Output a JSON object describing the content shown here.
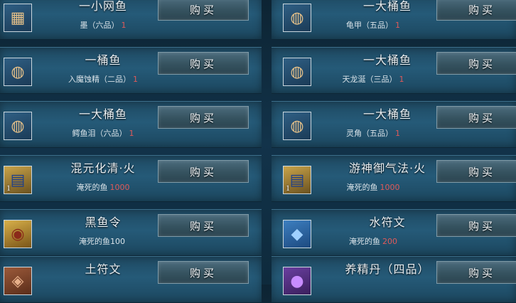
{
  "buy_label": "购买",
  "items": [
    {
      "name": "一小网鱼",
      "cost_text": "墨（六品）",
      "cost_num": "1",
      "icon": "net-icon",
      "icon_qty": ""
    },
    {
      "name": "一大桶鱼",
      "cost_text": "龟甲（五品）",
      "cost_num": "1",
      "icon": "bucket-icon",
      "icon_qty": ""
    },
    {
      "name": "一桶鱼",
      "cost_text": "入魔蚀精（二品）",
      "cost_num": "1",
      "icon": "bucket-icon",
      "icon_qty": ""
    },
    {
      "name": "一大桶鱼",
      "cost_text": "天龙涎（三品）",
      "cost_num": "1",
      "icon": "bucket-icon",
      "icon_qty": ""
    },
    {
      "name": "一大桶鱼",
      "cost_text": "鳄鱼泪（六品）",
      "cost_num": "1",
      "icon": "bucket-icon",
      "icon_qty": ""
    },
    {
      "name": "一大桶鱼",
      "cost_text": "灵角（五品）",
      "cost_num": "1",
      "icon": "bucket-icon",
      "icon_qty": ""
    },
    {
      "name": "混元化清·火",
      "cost_text": "淹死的鱼",
      "cost_num": "1000",
      "icon": "book-icon",
      "icon_qty": "1"
    },
    {
      "name": "游神御气法·火",
      "cost_text": "淹死的鱼",
      "cost_num": "1000",
      "icon": "book-icon",
      "icon_qty": "1"
    },
    {
      "name": "黑鱼令",
      "cost_text": "淹死的鱼100",
      "cost_num": "",
      "icon": "token-icon",
      "icon_qty": ""
    },
    {
      "name": "水符文",
      "cost_text": "淹死的鱼",
      "cost_num": "200",
      "icon": "water-rune-icon",
      "icon_qty": ""
    },
    {
      "name": "土符文",
      "cost_text": "",
      "cost_num": "",
      "icon": "earth-rune-icon",
      "icon_qty": ""
    },
    {
      "name": "养精丹（四品）",
      "cost_text": "",
      "cost_num": "",
      "icon": "pill-icon",
      "icon_qty": ""
    }
  ],
  "icon_glyphs": {
    "net-icon": "▦",
    "bucket-icon": "◍",
    "book-icon": "▤",
    "token-icon": "◉",
    "water-rune-icon": "◆",
    "earth-rune-icon": "◈",
    "pill-icon": "●"
  }
}
